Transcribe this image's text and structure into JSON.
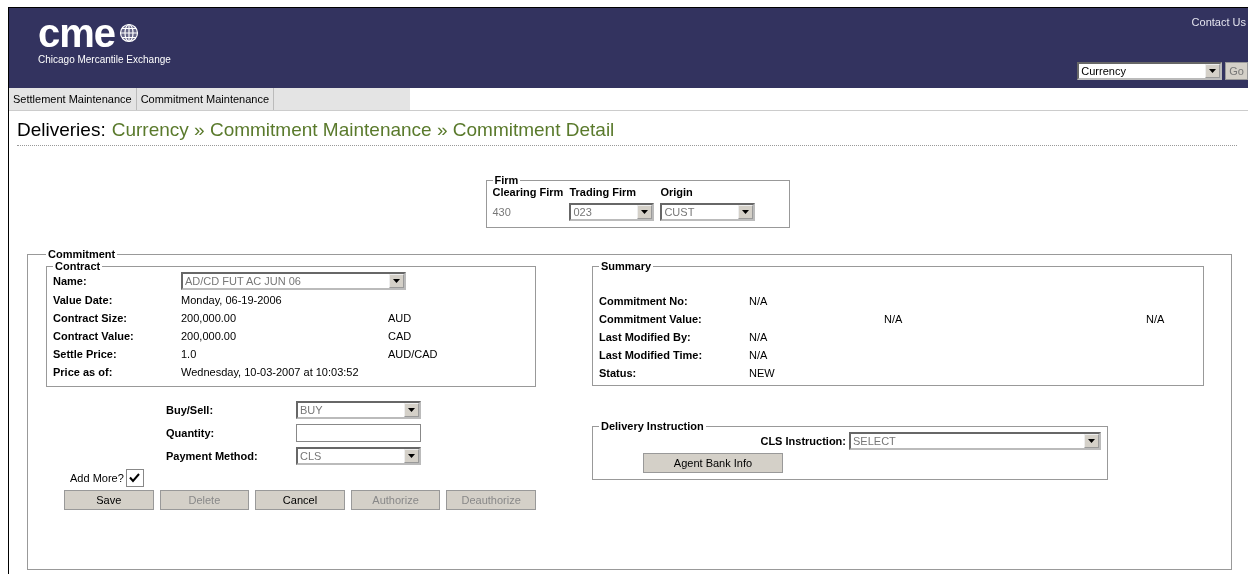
{
  "header": {
    "logo": "cme",
    "logo_subtitle": "Chicago Mercantile Exchange",
    "contact_link": "Contact Us",
    "market_select": {
      "value": "Currency"
    },
    "go_button": "Go"
  },
  "nav": [
    {
      "label": "Settlement Maintenance"
    },
    {
      "label": "Commitment Maintenance"
    }
  ],
  "breadcrumb": {
    "prefix": "Deliveries:",
    "path": "Currency » Commitment Maintenance » Commitment Detail"
  },
  "firm": {
    "legend": "Firm",
    "columns": [
      "Clearing Firm",
      "Trading Firm",
      "Origin"
    ],
    "clearing_firm": "430",
    "trading_firm": {
      "value": "023",
      "disabled": true
    },
    "origin": {
      "value": "CUST",
      "disabled": true
    }
  },
  "commitment": {
    "legend": "Commitment",
    "contract": {
      "legend": "Contract",
      "name_label": "Name:",
      "name_select": {
        "value": "AD/CD FUT AC JUN 06",
        "disabled": true
      },
      "rows": [
        {
          "label": "Value Date:",
          "value": "Monday, 06-19-2006"
        },
        {
          "label": "Contract Size:",
          "value": "200,000.00",
          "unit": "AUD"
        },
        {
          "label": "Contract Value:",
          "value": "200,000.00",
          "unit": "CAD"
        },
        {
          "label": "Settle Price:",
          "value": "1.0",
          "unit": "AUD/CAD"
        },
        {
          "label": "Price as of:",
          "value": "Wednesday, 10-03-2007 at 10:03:52"
        }
      ]
    },
    "summary": {
      "legend": "Summary",
      "rows": [
        {
          "label": "Commitment No:",
          "values": [
            "N/A"
          ]
        },
        {
          "label": "Commitment Value:",
          "kind": "split",
          "values": [
            "N/A",
            "N/A"
          ]
        },
        {
          "label": "Last Modified By:",
          "values": [
            "N/A"
          ]
        },
        {
          "label": "Last Modified Time:",
          "values": [
            "N/A"
          ]
        },
        {
          "label": "Status:",
          "values": [
            "NEW"
          ]
        }
      ]
    },
    "form": [
      {
        "label": "Buy/Sell:",
        "kind": "select",
        "value": "BUY",
        "disabled": true
      },
      {
        "label": "Quantity:",
        "kind": "input"
      },
      {
        "label": "Payment Method:",
        "kind": "select",
        "value": "CLS",
        "disabled": true
      }
    ],
    "add_more": {
      "label": "Add More?",
      "checked": true
    },
    "delivery": {
      "legend": "Delivery Instruction",
      "cls_label": "CLS Instruction:",
      "cls_select": {
        "value": "SELECT",
        "disabled": true
      },
      "agent_button": "Agent Bank Info"
    },
    "buttons": [
      {
        "label": "Save",
        "disabled": false
      },
      {
        "label": "Delete",
        "disabled": true
      },
      {
        "label": "Cancel",
        "disabled": false
      },
      {
        "label": "Authorize",
        "disabled": true
      },
      {
        "label": "Deauthorize",
        "disabled": true
      }
    ]
  }
}
